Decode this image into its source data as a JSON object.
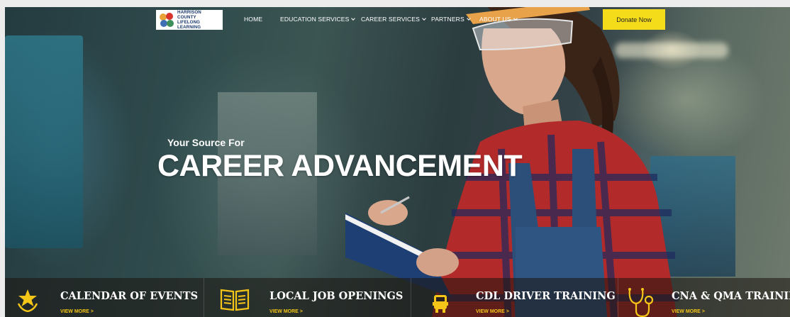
{
  "logo": {
    "line1": "HARRISON COUNTY",
    "line2": "LIFELONG LEARNING"
  },
  "nav": {
    "items": [
      {
        "label": "HOME",
        "dropdown": false
      },
      {
        "label": "EDUCATION SERVICES",
        "dropdown": true
      },
      {
        "label": "CAREER SERVICES",
        "dropdown": true
      },
      {
        "label": "PARTNERS",
        "dropdown": true
      },
      {
        "label": "ABOUT US",
        "dropdown": true
      }
    ],
    "donate_label": "Donate Now"
  },
  "hero": {
    "subtitle": "Your Source For",
    "title": "CAREER ADVANCEMENT"
  },
  "features": [
    {
      "title": "CALENDAR OF EVENTS",
      "link": "VIEW MORE >",
      "icon": "star-laurel-icon"
    },
    {
      "title": "LOCAL JOB OPENINGS",
      "link": "VIEW MORE >",
      "icon": "open-book-icon"
    },
    {
      "title": "CDL DRIVER TRAINING",
      "link": "VIEW MORE >",
      "icon": "truck-icon"
    },
    {
      "title": "CNA & QMA TRAINING",
      "link": "VIEW MORE >",
      "icon": "stethoscope-icon"
    }
  ],
  "colors": {
    "accent": "#f5dc1a",
    "link": "#f5c518",
    "logo_text": "#1b3a6b"
  }
}
